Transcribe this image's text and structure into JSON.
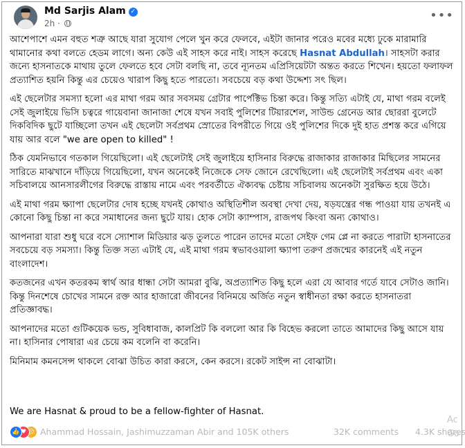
{
  "post": {
    "author": "Md Sarjis Alam",
    "time": "2h",
    "separator": "·",
    "p1_a": "আশেপাশে এমন বহুত শত্রু আছে যারা সুযোগ পেলে খুন করে ফেলবে, এইটা জানার পরেও মবের মধ্যে ঢুকে মারামারি থামানোর কথা বলতে হেডম লাগে। অন্য কেউ এই সাহস করে নাই। সাহস করেছে",
    "mention": "Hasnat Abdullah",
    "p1_b": "। সাহসটা করার জন্যে হাসনাতকে মাথায় তুলে ফেলতে হবে সেটা বলছি না, তবে ন্যূনতম এপ্রিসিয়েটটা অন্তত করতে শিখেন। হয়তো ফলাফল প্রত্যাশিত হয়নি কিন্তু এর চেয়েও খারাপ কিছু হতে পারতো। সবচেয়ে বড় কথা উদ্দেশ্য সৎ ছিল।",
    "p2": "এই ছেলেটার সমস্যা হলো এর মাথা গরম আর সবসময় গ্রেটার পার্পেক্টিভ চিন্তা করে। কিন্তু সত্যি এটাই যে, মাথা গরম বলেই সেই জুলাইয়ে ভিসি চত্বরে গায়েবানা জানাজা শেষে যখন সবাই পুলিশের টিয়ারশেল, সাউন্ড গ্রেনেড আর ছোররা বুলেটে দিকবিদিক ছুটে যাচ্ছিলো তখন এই ছেলেটা সর্বপ্রথম স্রোতের বিপরীতে গিয়ে ওই পুলিশের দিকে দুই হাত প্রশস্ত করে এগিয়ে যায় আর বলে \"we are open to killed\" !",
    "p3": "ঠিক যেমনিভাবে গতকাল গিয়েছিলো। এই ছেলেটাই সেই জুলাইয়ে হাসিনার বিরুদ্ধে রাজাকার রাজাকার মিছিলের সামনের সারিতে মাঝখানে দাঁড়িয়ে গিয়েছিলো, যখন অনেকেই নিজেকে সেফ জোনে রেখেছিলো। এই ছেলেটাই সর্বপ্রথম এবং একা সচিবালয়ে আনসারলীগের বিরুদ্ধে রাস্তায় নামে এবং পরবর্তীতে ঐক্যবদ্ধ চেষ্টায় সচিবালয় অনেকটা সুরক্ষিত হয়ে উঠে।",
    "p4": "এই মাথা গরম ক্ষ্যাপা ছেলেটার দোষ হচ্ছে যখনই কোথাও অস্থিতিশীল অবস্থা দেখা দেয়, ষড়যন্ত্রের গন্ধ পাওয়া যায় তখনই এ কোনো কিছু চিন্তা না করে সমাধানের জন্য ছুটে যায়। হোক সেটা ক্যাম্পাস, রাজপথ কিংবা অন্য কোথাও।",
    "p5": "আপনারা যারা শুধু ঘরে বসে স্যোশাল মিডিয়ার ঝড় তুলতে পারেন তাদের মতো সেইফ গেম প্লে না করতে পারাটা হাসনাতের সবচেয়ে বড় সমস্যা। কিন্তু তিক্ত সত্য এটাই যে, এই মাথা গরম স্বভাবওয়ালা ক্ষ্যাপা তরুণ প্রজন্মের কারনেই এই নতুন বাংলাদেশ।",
    "p6": "কতজনের এখন কতরকম স্বার্থ আর ধান্ধা সেটা আমরা বুঝি, অপ্রত্যাশিত কিছু হলে এরা যে আবার গর্তে যাবে সেটাও জানি। কিন্তু দিনশেষে চোখের সামনে রক্ত আর হাজারো জীবনের বিনিময়ে অর্জিত নতুন স্বাধীনতা রক্ষা করতে হাসনাতরা প্রতিজ্ঞাবদ্ধ।",
    "p7": "আপনাদের মতো গুটিকয়েক ভন্ড, সুবিধাবাজ, কালপ্রিট কি বললো আর কি বিহেভ করলো তাতে আমাদের কিছু আসে যায় না। হাসিনার পোষারা এর চেয়ে কম বলেনি বা করেনি।",
    "p8": "মিনিমাম কমনসেন্স থাকলে বোঝা উচিত কারা করসে, কেন করসে। রকেট সাইন্স না বোঝাটা।",
    "closing": "We are Hasnat & proud to be a fellow-fighter of Hasnat."
  },
  "footer": {
    "reactors": "Ahammad Hossain, Jashimuzzaman Abir and 105K others",
    "comments": "32K comments",
    "shares": "4.3K shares"
  },
  "watermark": {
    "line1": "Ac",
    "line2": "Go"
  },
  "icons": {
    "verified": "verified-badge-icon",
    "audience": "globe-icon",
    "menu": "more-options-icon",
    "reactions": [
      "like-reaction-icon",
      "love-reaction-icon",
      "sad-reaction-icon"
    ]
  },
  "colors": {
    "mention": "#1d63c8",
    "verified": "#1877f2",
    "like": "#1877f2",
    "love": "#f33e58",
    "sad": "#f7b125"
  }
}
